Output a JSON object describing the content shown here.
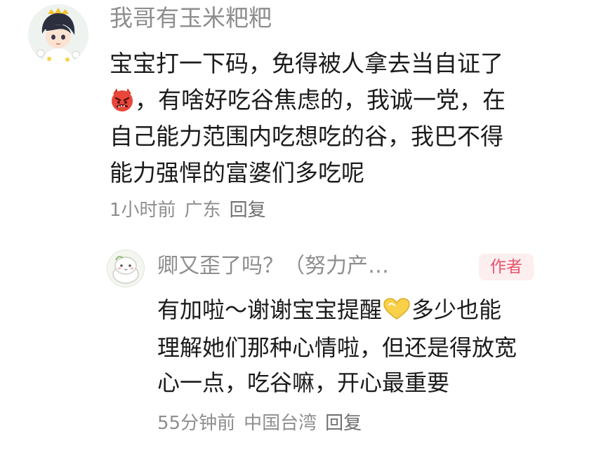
{
  "comment": {
    "username": "我哥有玉米粑粑",
    "lines": [
      "宝宝打一下码，免得被人拿去当自证了",
      "，有啥好吃谷焦虑的，我诚一党，在",
      "自己能力范围内吃想吃的谷，我巴不得",
      "能力强悍的富婆们多吃呢"
    ],
    "emoji_icon": "angry-devil-emoji-icon",
    "time": "1小时前",
    "location": "广东",
    "reply_label": "回复"
  },
  "reply": {
    "username": "卿又歪了吗？（努力产…",
    "author_badge": "作者",
    "lines": {
      "l1_start": "有加啦～谢谢宝宝提醒",
      "l1_end": "多少也能",
      "l2": "理解她们那种心情啦，但还是得放宽",
      "l3": "心一点，吃谷嘛，开心最重要"
    },
    "emoji_icon": "heart-hands-emoji-icon",
    "time": "55分钟前",
    "location": "中国台湾",
    "reply_label": "回复"
  },
  "colors": {
    "text": "#1b1b1b",
    "meta": "#8e8e8e",
    "author_badge_bg": "#fdeef0",
    "author_badge_text": "#e8546c"
  }
}
